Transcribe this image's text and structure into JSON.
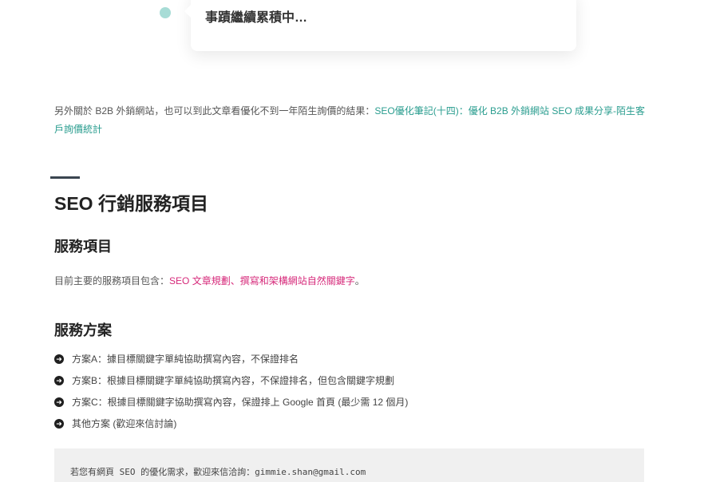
{
  "timeline": {
    "card_text": "事蹟繼續累積中…"
  },
  "intro": {
    "prefix": "另外關於 B2B 外銷網站，也可以到此文章看優化不到一年陌生詢價的結果：",
    "link_text": "SEO優化筆記(十四)：優化 B2B 外銷網站 SEO 成果分享-陌生客戶詢價統計"
  },
  "section": {
    "title": "SEO 行銷服務項目"
  },
  "services": {
    "heading": "服務項目",
    "prefix": "目前主要的服務項目包含：",
    "highlight": "SEO 文章規劃、撰寫和架構網站自然關鍵字",
    "suffix": "。"
  },
  "plans": {
    "heading": "服務方案",
    "items": [
      "方案A：據目標關鍵字單純協助撰寫內容，不保證排名",
      "方案B：根據目標關鍵字單純協助撰寫內容，不保證排名，但包含關鍵字規劃",
      "方案C：根據目標關鍵字協助撰寫內容，保證排上 Google 首頁 (最少需 12 個月)",
      "其他方案 (歡迎來信討論)"
    ],
    "bullet_icon": "arrow-circle-right-icon"
  },
  "contact": {
    "text": "若您有網頁 SEO 的優化需求，歡迎來信洽詢：gimmie.shan@gmail.com"
  },
  "colors": {
    "link": "#2a9d8f",
    "highlight": "#d6297a",
    "timeline_dot": "#a7dcd6"
  }
}
